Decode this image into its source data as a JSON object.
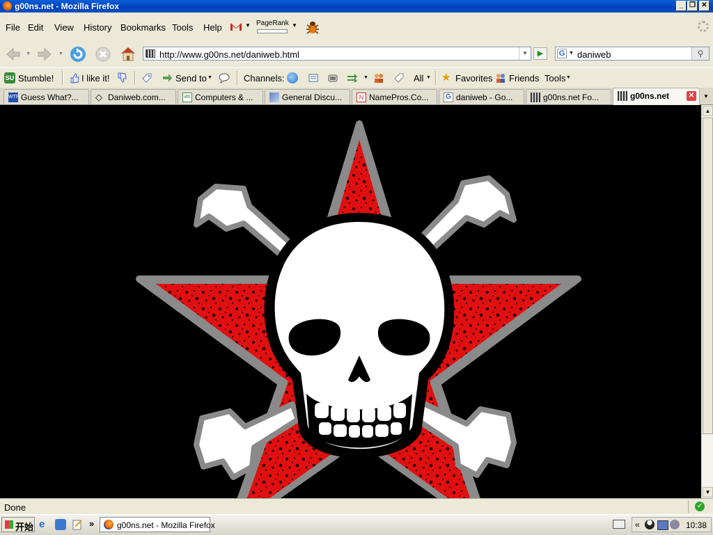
{
  "window": {
    "title": "g00ns.net - Mozilla Firefox"
  },
  "menu": {
    "file": "File",
    "edit": "Edit",
    "view": "View",
    "history": "History",
    "bookmarks": "Bookmarks",
    "tools": "Tools",
    "help": "Help",
    "pagerank": "PageRank"
  },
  "nav": {
    "url": "http://www.g00ns.net/daniweb.html",
    "search_value": "daniweb"
  },
  "stumble": {
    "stumble": "Stumble!",
    "like": "I like it!",
    "send_to": "Send to",
    "channels": "Channels:",
    "all": "All",
    "favorites": "Favorites",
    "friends": "Friends",
    "tools": "Tools"
  },
  "tabs": [
    {
      "label": "Guess What?..."
    },
    {
      "label": "Daniweb.com..."
    },
    {
      "label": "Computers & ..."
    },
    {
      "label": "General Discu..."
    },
    {
      "label": "NamePros.Co..."
    },
    {
      "label": "daniweb - Go..."
    },
    {
      "label": "g00ns.net Fo..."
    },
    {
      "label": "g00ns.net"
    }
  ],
  "status": {
    "text": "Done"
  },
  "taskbar": {
    "start": "开始",
    "item": "g00ns.net - Mozilla Firefox",
    "clock": "10:38"
  },
  "colors": {
    "star_red": "#e01010",
    "bg": "#000000"
  }
}
